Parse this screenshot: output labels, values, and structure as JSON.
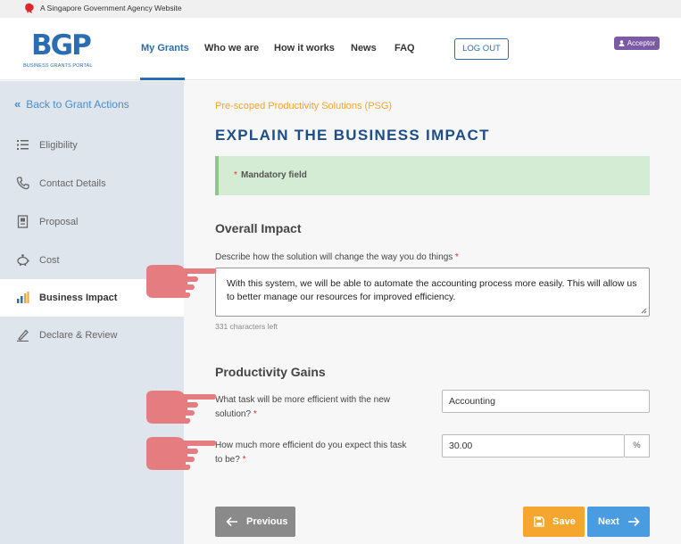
{
  "gov_banner": {
    "text": "A Singapore Government Agency Website"
  },
  "header": {
    "logo_text": "BGP",
    "logo_subtext": "BUSINESS GRANTS PORTAL",
    "nav": [
      "My Grants",
      "Who we are",
      "How it works",
      "News",
      "FAQ"
    ],
    "logout_label": "LOG OUT",
    "role_badge": "Acceptor"
  },
  "sidebar": {
    "back_label": "Back to Grant Actions",
    "items": [
      {
        "label": "Eligibility",
        "icon": "list-icon"
      },
      {
        "label": "Contact Details",
        "icon": "phone-icon"
      },
      {
        "label": "Proposal",
        "icon": "document-icon"
      },
      {
        "label": "Cost",
        "icon": "piggy-bank-icon"
      },
      {
        "label": "Business Impact",
        "icon": "bar-chart-icon",
        "active": true
      },
      {
        "label": "Declare & Review",
        "icon": "pen-icon"
      }
    ]
  },
  "main": {
    "subtitle": "Pre-scoped Productivity Solutions (PSG)",
    "title": "EXPLAIN THE BUSINESS IMPACT",
    "mandatory_star": "*",
    "mandatory_text": "Mandatory field",
    "overall": {
      "heading": "Overall Impact",
      "question": "Describe how the solution will change the way you do things",
      "answer": "With this system, we will be able to  automate the accounting process more easily. This will allow us to better manage our resources for improved efficiency.",
      "chars_left": "331 characters left"
    },
    "productivity": {
      "heading": "Productivity Gains",
      "q1_line1": "What task will be more efficient with the new",
      "q1_line2": "solution?",
      "q1_value": "Accounting",
      "q2_line1": "How much more efficient do you expect this task",
      "q2_line2": "to be?",
      "q2_value": "30.00",
      "q2_suffix": "%"
    },
    "required_star": "*",
    "buttons": {
      "previous": "Previous",
      "save": "Save",
      "next": "Next"
    }
  },
  "colors": {
    "brand_blue": "#1d4e89",
    "link_blue": "#2a6db3",
    "accent_orange": "#f4a433",
    "mandatory_bg": "#d4ecd4",
    "sidebar_bg": "#dfe5ec",
    "pointer_hand": "#e47c80"
  }
}
